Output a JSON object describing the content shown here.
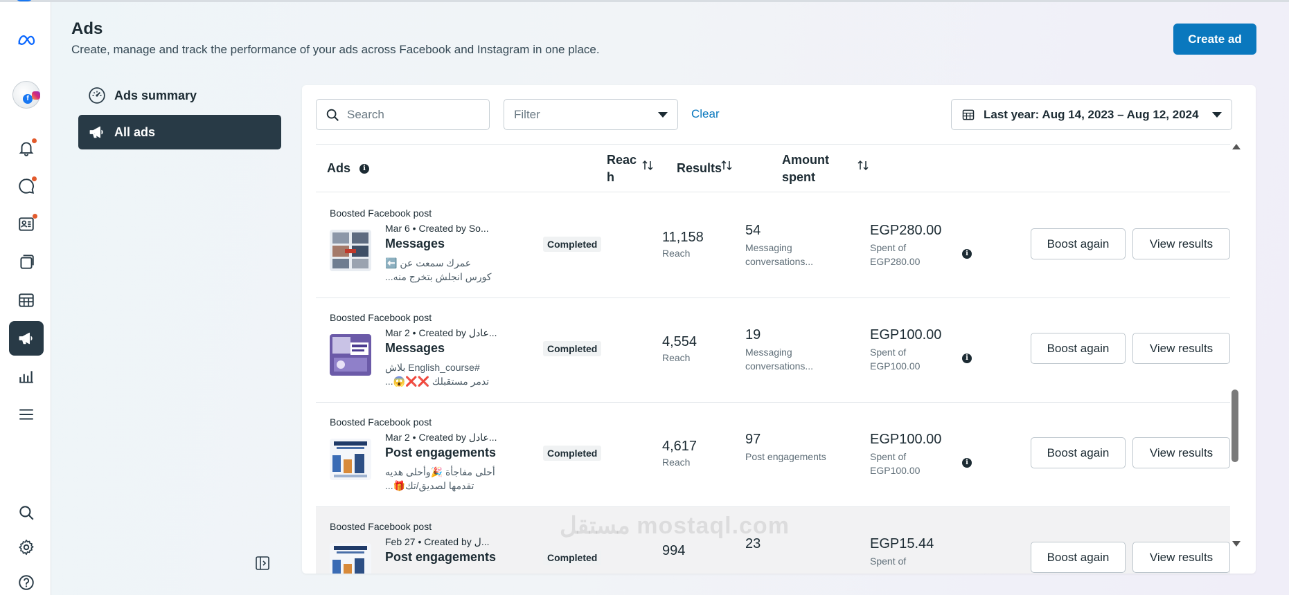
{
  "header": {
    "title": "Ads",
    "subtitle": "Create, manage and track the performance of your ads across Facebook and Instagram in one place.",
    "create_label": "Create ad"
  },
  "sidebar": {
    "items": [
      {
        "label": "Ads summary",
        "icon": "gauge-icon"
      },
      {
        "label": "All ads",
        "icon": "megaphone-icon"
      }
    ]
  },
  "toolbar": {
    "search_placeholder": "Search",
    "filter_placeholder": "Filter",
    "clear_label": "Clear",
    "date_range": "Last year: Aug 14, 2023 – Aug 12, 2024"
  },
  "table": {
    "columns": {
      "ads": "Ads",
      "reach": "Reac h",
      "results": "Results",
      "amount": "Amount spent"
    },
    "rows": [
      {
        "type": "Boosted Facebook post",
        "meta": "Mar 6 • Created by So...",
        "title": "Messages",
        "desc": "عمرك سمعت عن ⬅️ كورس انجلش بتخرج منه...",
        "status": "Completed",
        "reach": "11,158",
        "reach_label": "Reach",
        "result": "54",
        "result_label": "Messaging conversations...",
        "amount": "EGP280.00",
        "amount_label": "Spent of EGP280.00",
        "boost_label": "Boost again",
        "view_label": "View results"
      },
      {
        "type": "Boosted Facebook post",
        "meta": "Mar 2 • Created by عادل...",
        "title": "Messages",
        "desc": "#English_course بلاش تدمر مستقبلك ❌❌😱...",
        "status": "Completed",
        "reach": "4,554",
        "reach_label": "Reach",
        "result": "19",
        "result_label": "Messaging conversations...",
        "amount": "EGP100.00",
        "amount_label": "Spent of EGP100.00",
        "boost_label": "Boost again",
        "view_label": "View results"
      },
      {
        "type": "Boosted Facebook post",
        "meta": "Mar 2 • Created by عادل...",
        "title": "Post engagements",
        "desc": "أحلى مفاجأة 🎉وأحلى هديه تقدمها لصديق/تك🎁...",
        "status": "Completed",
        "reach": "4,617",
        "reach_label": "Reach",
        "result": "97",
        "result_label": "Post engagements",
        "amount": "EGP100.00",
        "amount_label": "Spent of EGP100.00",
        "boost_label": "Boost again",
        "view_label": "View results"
      },
      {
        "type": "Boosted Facebook post",
        "meta": "Feb 27 • Created by ل...",
        "title": "Post engagements",
        "desc": "",
        "status": "Completed",
        "reach": "994",
        "reach_label": "Reach",
        "result": "23",
        "result_label": "",
        "amount": "EGP15.44",
        "amount_label": "Spent of",
        "boost_label": "Boost again",
        "view_label": "View results"
      }
    ]
  },
  "watermark": "مستقل mostaql.com",
  "colors": {
    "primary": "#0a78be",
    "nav_active": "#283a46",
    "badge": "#e25a2c"
  }
}
